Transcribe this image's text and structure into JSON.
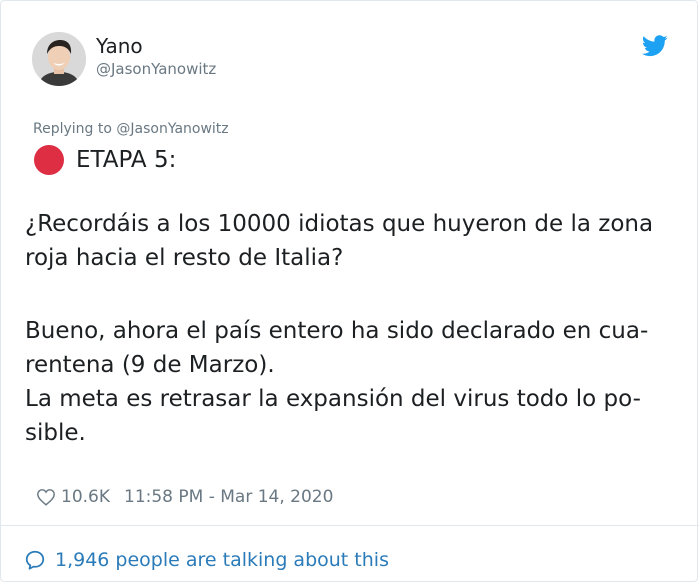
{
  "tweet": {
    "author_name": "Yano",
    "author_handle": "@JasonYanowitz",
    "reply_context": "Replying to @JasonYanowitz",
    "heading": "ETAPA 5:",
    "paragraph1_lines": [
      "¿Recordáis a los 10000 idiotas que huyeron de la zona",
      "roja hacia el resto de Italia?"
    ],
    "paragraph2_lines": [
      "Bueno, ahora el país entero ha sido declarado en cua-",
      "rentena (9 de Marzo).",
      "La meta es retrasar la expansión del virus todo lo po-",
      "sible."
    ],
    "likes": "10.6K",
    "timestamp": "11:58 PM - Mar 14, 2020",
    "talking_about": "1,946 people are talking about this"
  },
  "icons": {
    "brand": "twitter-bird-icon",
    "like": "heart-icon",
    "discussion": "speech-bubble-icon",
    "emoji": "red-circle"
  },
  "colors": {
    "twitter_blue": "#1da1f2",
    "link_blue": "#2b7bb9",
    "muted_text": "#697882",
    "red_circle": "#dd2e44",
    "border": "#e1e8ed"
  }
}
